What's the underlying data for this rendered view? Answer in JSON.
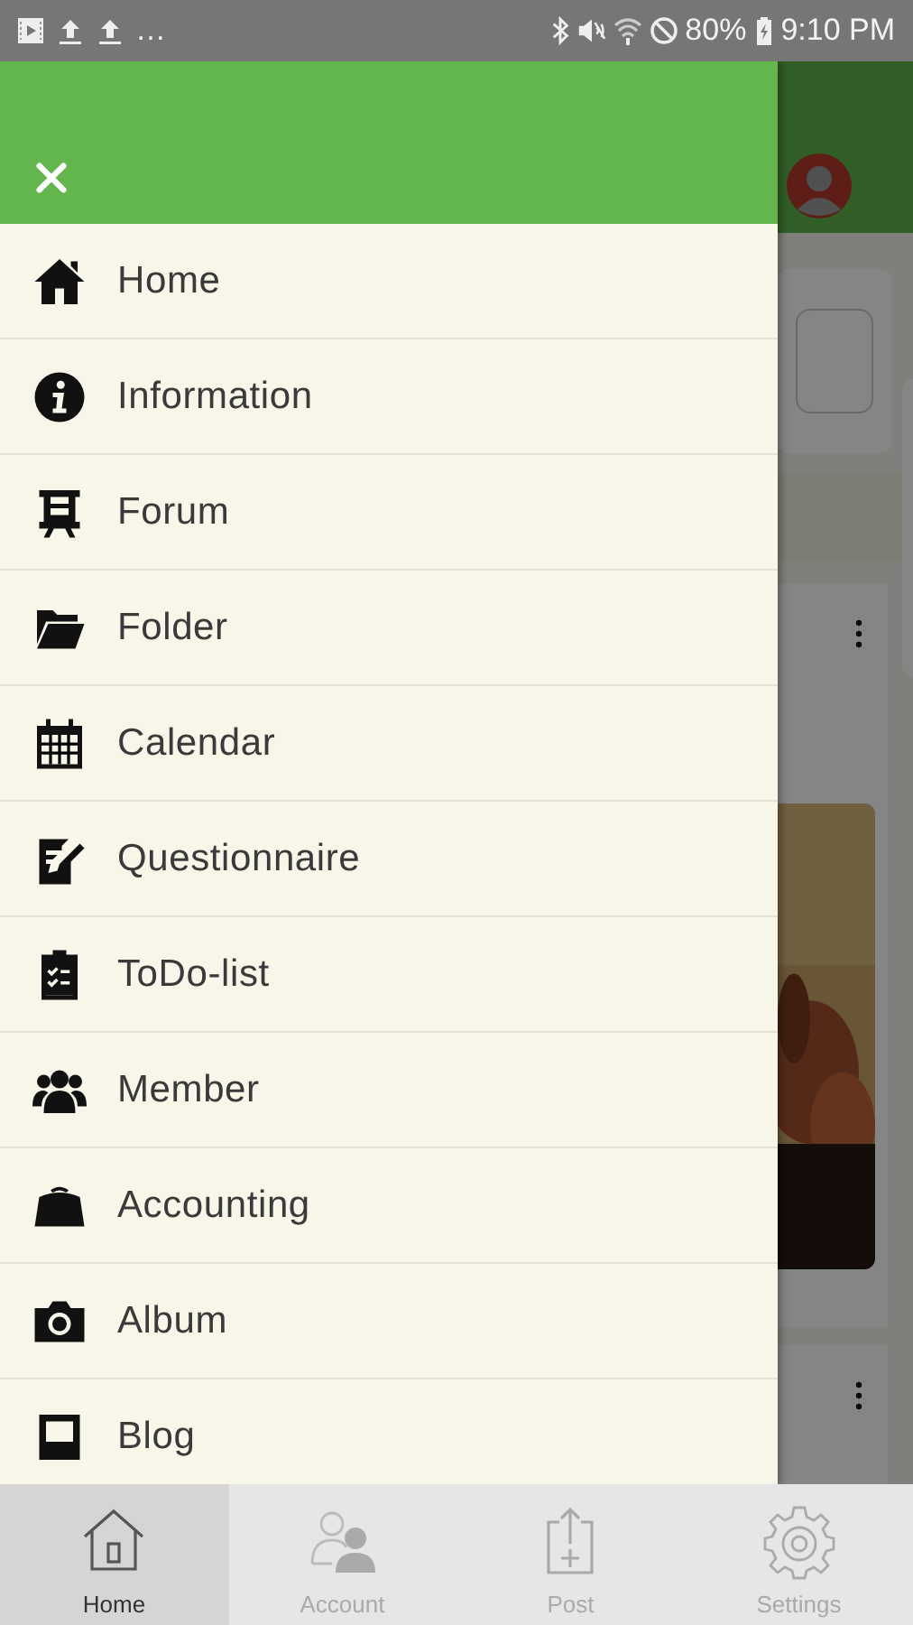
{
  "status_bar": {
    "overflow": "…",
    "battery": "80%",
    "time": "9:10 PM"
  },
  "drawer": {
    "menu": [
      {
        "kind": "home",
        "label": "Home"
      },
      {
        "kind": "info",
        "label": "Information"
      },
      {
        "kind": "forum",
        "label": "Forum"
      },
      {
        "kind": "folder",
        "label": "Folder"
      },
      {
        "kind": "calendar",
        "label": "Calendar"
      },
      {
        "kind": "questionnaire",
        "label": "Questionnaire"
      },
      {
        "kind": "todo",
        "label": "ToDo-list"
      },
      {
        "kind": "member",
        "label": "Member"
      },
      {
        "kind": "accounting",
        "label": "Accounting"
      },
      {
        "kind": "album",
        "label": "Album"
      },
      {
        "kind": "blog",
        "label": "Blog"
      }
    ]
  },
  "bottom_nav": [
    {
      "kind": "home",
      "label": "Home",
      "selected": true
    },
    {
      "kind": "account",
      "label": "Account",
      "selected": false
    },
    {
      "kind": "post",
      "label": "Post",
      "selected": false
    },
    {
      "kind": "settings",
      "label": "Settings",
      "selected": false
    }
  ]
}
